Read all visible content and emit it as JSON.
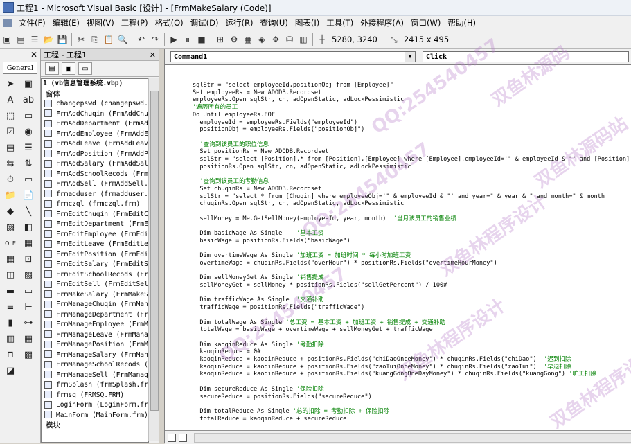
{
  "window": {
    "title": "工程1 - Microsoft Visual Basic [设计] - [FrmMakeSalary (Code)]"
  },
  "menu": [
    "文件(F)",
    "编辑(E)",
    "视图(V)",
    "工程(P)",
    "格式(O)",
    "调试(D)",
    "运行(R)",
    "查询(U)",
    "图表(I)",
    "工具(T)",
    "外接程序(A)",
    "窗口(W)",
    "帮助(H)"
  ],
  "toolbar": {
    "position": "5280, 3240",
    "size": "2415 x 495"
  },
  "toolbox": {
    "tab_label": "General",
    "tools": [
      "pointer-icon",
      "picturebox-icon",
      "label-icon",
      "textbox-icon",
      "frame-icon",
      "commandbutton-icon",
      "checkbox-icon",
      "optionbutton-icon",
      "combobox-icon",
      "listbox-icon",
      "hscrollbar-icon",
      "vscrollbar-icon",
      "timer-icon",
      "drivelist-icon",
      "dirlist-icon",
      "filelist-icon",
      "shape-icon",
      "line-icon",
      "image-icon",
      "data-icon",
      "ole-icon",
      "calendar-icon",
      "grid-icon",
      "adodc-icon",
      "chart-icon",
      "richtext-icon",
      "toolbar-icon",
      "status-icon",
      "listview-icon",
      "treeview-icon",
      "progress-icon",
      "slider-icon",
      "flexgrid-icon",
      "datagrid-icon",
      "tabstrip-icon",
      "imagelist-icon",
      "common-dialog-icon"
    ]
  },
  "project": {
    "header": "工程 - 工程1",
    "root": "1 (vb信息管理系统.vbp)",
    "forms_folder": "窗体",
    "modules_folder": "模块",
    "items": [
      "changepswd (changepswd.f",
      "FrmAddChuqin (FrmAddChuq",
      "FrmAddDepartment (FrmAdd",
      "FrmAddEmployee (FrmAddEm",
      "FrmAddLeave (FrmAddLeave",
      "FrmAddPosition (FrmAddPo",
      "FrmAddSalary (FrmAddSala",
      "FrmAddSchoolRecods (FrmA",
      "FrmAddSell (FrmAddSell.f",
      "frmadduser (frmadduser.f",
      "frmczql (frmczql.frm)",
      "FrmEditChuqin (FrmEditCh",
      "FrmEditDepartment (FrmEd",
      "FrmEditEmployee (FrmEdit",
      "FrmEditLeave (FrmEditLea",
      "FrmEditPosition (FrmEdit",
      "FrmEditSalary (FrmEditSa",
      "FrmEditSchoolRecods (Frm",
      "FrmEditSell (FrmEditSell",
      "FrmMakeSalary (FrmMakeSa",
      "FrmManageChuqin (FrmMana",
      "FrmManageDepartment (Frm",
      "FrmManageEmployee (FrmMa",
      "FrmManageLeave (FrmManag",
      "FrmManagePosition (FrmMa",
      "FrmManageSalary (FrmMana",
      "FrmManageSchoolRecods (F",
      "FrmManageSell (FrmManage",
      "frmSplash (frmSplash.frm",
      "frmsq (FRMSQ.FRM)",
      "LoginForm (LoginForm.frm",
      "MainForm (MainForm.frm)"
    ]
  },
  "code_window": {
    "object_combo": "Command1",
    "proc_combo": "Click",
    "lines": [
      {
        "t": "sqlStr = \"select employeeId,positionObj from [Employee]\"",
        "c": ""
      },
      {
        "t": "Set employeeRs = New ADODB.Recordset",
        "c": ""
      },
      {
        "t": "employeeRs.Open sqlStr, cn, adOpenStatic, adLockPessimistic",
        "c": ""
      },
      {
        "t": "",
        "c": "'遍历所有的员工"
      },
      {
        "t": "Do Until employeeRs.EOF",
        "c": ""
      },
      {
        "t": "  employeeId = employeeRs.Fields(\"employeeId\")",
        "c": ""
      },
      {
        "t": "  positionObj = employeeRs.Fields(\"positionObj\")",
        "c": ""
      },
      {
        "t": "",
        "c": ""
      },
      {
        "t": "  ",
        "c": "'查询到该员工的职位信息"
      },
      {
        "t": "  Set positionRs = New ADODB.Recordset",
        "c": ""
      },
      {
        "t": "  sqlStr = \"select [Position].* from [Position],[Employee] where [Employee].employeeId='\" & employeeId & \"' and [Position].",
        "c": ""
      },
      {
        "t": "  positionRs.Open sqlStr, cn, adOpenStatic, adLockPessimistic",
        "c": ""
      },
      {
        "t": "",
        "c": ""
      },
      {
        "t": "  ",
        "c": "'查询到该员工的考勤信息"
      },
      {
        "t": "  Set chuqinRs = New ADODB.Recordset",
        "c": ""
      },
      {
        "t": "  sqlStr = \"select * from [Chuqin] where employeeObj='\" & employeeId & \"' and year=\" & year & \" and month=\" & month",
        "c": ""
      },
      {
        "t": "  chuqinRs.Open sqlStr, cn, adOpenStatic, adLockPessimistic",
        "c": ""
      },
      {
        "t": "",
        "c": ""
      },
      {
        "t": "  sellMoney = Me.GetSellMoney(employeeId, year, month)  ",
        "c": "'当月该员工的销售业绩"
      },
      {
        "t": "",
        "c": ""
      },
      {
        "t": "  Dim basicWage As Single    ",
        "c": "'基本工资"
      },
      {
        "t": "  basicWage = positionRs.Fields(\"basicWage\")",
        "c": ""
      },
      {
        "t": "",
        "c": ""
      },
      {
        "t": "  Dim overtimeWage As Single ",
        "c": "'加班工资 = 加班时间 * 每小时加班工资"
      },
      {
        "t": "  overtimeWage = chuqinRs.Fields(\"overHour\") * positionRs.Fields(\"overtimeHourMoney\")",
        "c": ""
      },
      {
        "t": "",
        "c": ""
      },
      {
        "t": "  Dim sellMoneyGet As Single ",
        "c": "'销售提成"
      },
      {
        "t": "  sellMoneyGet = sellMoney * positionRs.Fields(\"sellGetPercent\") / 100#",
        "c": ""
      },
      {
        "t": "",
        "c": ""
      },
      {
        "t": "  Dim trafficWage As Single  ",
        "c": "'交通补助"
      },
      {
        "t": "  trafficWage = positionRs.Fields(\"trafficWage\")",
        "c": ""
      },
      {
        "t": "",
        "c": ""
      },
      {
        "t": "  Dim totalWage As Single ",
        "c": "'总工资 = 基本工资 + 加班工资 + 销售提成 + 交通补助"
      },
      {
        "t": "  totalWage = basicWage + overtimeWage + sellMoneyGet + trafficWage",
        "c": ""
      },
      {
        "t": "",
        "c": ""
      },
      {
        "t": "  Dim kaoqinReduce As Single ",
        "c": "'考勤扣除"
      },
      {
        "t": "  kaoqinReduce = 0#",
        "c": ""
      },
      {
        "t": "  kaoqinReduce = kaoqinReduce + positionRs.Fields(\"chiDaoOnceMoney\") * chuqinRs.Fields(\"chiDao\")  ",
        "c": "'迟到扣除"
      },
      {
        "t": "  kaoqinReduce = kaoqinReduce + positionRs.Fields(\"zaoTuiOnceMoney\") * chuqinRs.Fields(\"zaoTui\")  ",
        "c": "'早退扣除"
      },
      {
        "t": "  kaoqinReduce = kaoqinReduce + positionRs.Fields(\"kuangGongOneDayMoney\") * chuqinRs.Fields(\"kuangGong\") ",
        "c": "'旷工扣除"
      },
      {
        "t": "",
        "c": ""
      },
      {
        "t": "  Dim secureReduce As Single ",
        "c": "'保险扣除"
      },
      {
        "t": "  secureReduce = positionRs.Fields(\"secureReduce\")",
        "c": ""
      },
      {
        "t": "",
        "c": ""
      },
      {
        "t": "  Dim totalReduce As Single ",
        "c": "'总的扣除 = 考勤扣除 + 保险扣除"
      },
      {
        "t": "  totalReduce = kaoqinReduce + secureReduce",
        "c": ""
      }
    ]
  },
  "watermarks": [
    "QQ:254540457",
    "双鱼林源码",
    "双鱼林程序设计",
    "双鱼林源码站",
    "QQ:254540457",
    "双鱼林程序设计",
    "QQ:254540457",
    "双鱼林程序设计"
  ]
}
